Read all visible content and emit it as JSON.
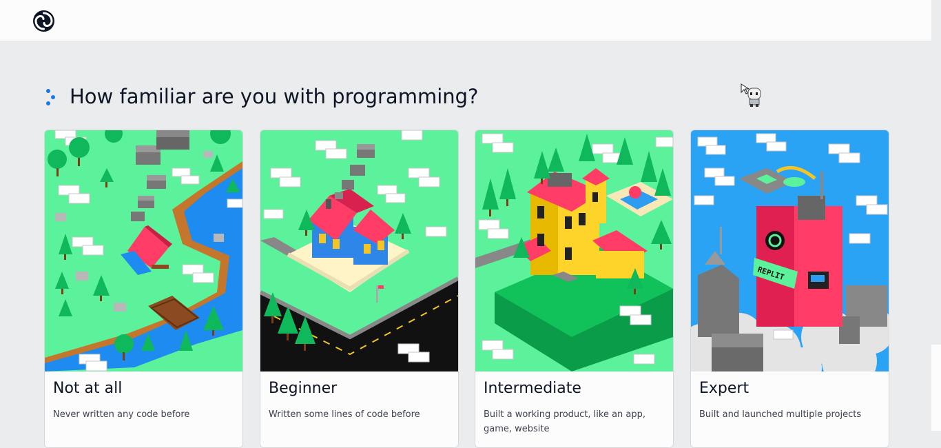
{
  "header": {
    "logo_icon": "replit-logo-icon"
  },
  "main": {
    "question": "How familiar are you with programming?",
    "options": [
      {
        "title": "Not at all",
        "description": "Never written any code before",
        "icon": "campsite-illustration"
      },
      {
        "title": "Beginner",
        "description": "Written some lines of code before",
        "icon": "house-illustration"
      },
      {
        "title": "Intermediate",
        "description": "Built a working product, like an app, game, website",
        "icon": "mansion-illustration"
      },
      {
        "title": "Expert",
        "description": "Built and launched multiple projects",
        "icon": "skyscraper-illustration"
      }
    ],
    "building_sign": "REPLIT"
  },
  "colors": {
    "grass": "#5cf29b",
    "sky": "#2ba3f5",
    "roof_red": "#ff3c65",
    "water": "#1e8bf0",
    "accent_blue": "#1b7ae6"
  }
}
